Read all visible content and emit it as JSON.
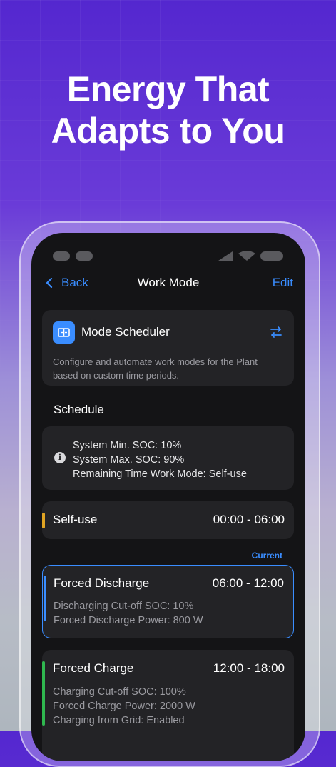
{
  "headline": {
    "line1": "Energy That",
    "line2": "Adapts to You"
  },
  "nav": {
    "back_label": "Back",
    "title": "Work Mode",
    "edit_label": "Edit"
  },
  "scheduler": {
    "title": "Mode Scheduler",
    "description": "Configure and automate work modes for the Plant based on custom time periods."
  },
  "schedule": {
    "section_label": "Schedule",
    "info": {
      "min_soc": "System Min. SOC: 10%",
      "max_soc": "System Max. SOC: 90%",
      "remaining": "Remaining Time Work Mode: Self-use"
    }
  },
  "current_label": "Current",
  "modes": [
    {
      "name": "Self-use",
      "time": "00:00 - 06:00",
      "color": "#e0a423",
      "details": []
    },
    {
      "name": "Forced Discharge",
      "time": "06:00 - 12:00",
      "color": "#3a8dff",
      "details": [
        "Discharging Cut-off SOC: 10%",
        "Forced Discharge Power: 800 W"
      ]
    },
    {
      "name": "Forced Charge",
      "time": "12:00 - 18:00",
      "color": "#2fb84f",
      "details": [
        "Charging Cut-off SOC: 100%",
        "Forced Charge Power: 2000 W",
        "Charging from Grid: Enabled"
      ]
    }
  ],
  "colors": {
    "accent": "#3a8dff",
    "background_top": "#5427cf",
    "phone_bg": "#141416",
    "card_bg": "#232326"
  }
}
